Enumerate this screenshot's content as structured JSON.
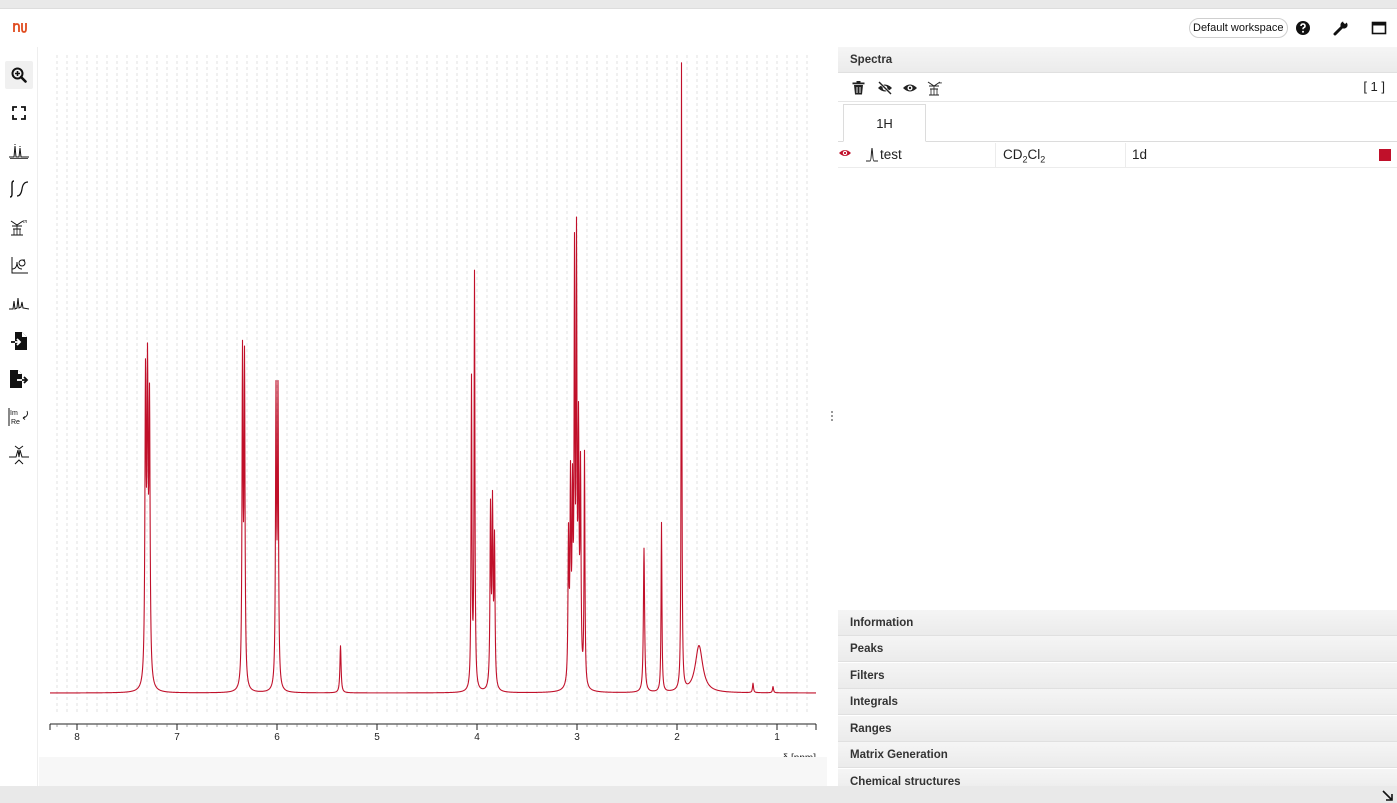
{
  "topbar": {
    "logo": "nmrium-logo",
    "workspace_label": "Default workspace",
    "icons": [
      "help-icon",
      "wrench-icon",
      "window-icon"
    ]
  },
  "toolbar": {
    "tools": [
      {
        "name": "zoom-tool",
        "icon": "zoom-in-icon",
        "active": true
      },
      {
        "name": "full-screen-tool",
        "icon": "fullscreen-icon"
      },
      {
        "name": "peak-picking-tool",
        "icon": "peak-picking-icon"
      },
      {
        "name": "integral-tool",
        "icon": "integral-icon"
      },
      {
        "name": "multiplet-tool",
        "icon": "multiplet-icon"
      },
      {
        "name": "phase-correction-tool",
        "icon": "phase-icon"
      },
      {
        "name": "baseline-tool",
        "icon": "baseline-icon"
      },
      {
        "name": "import-tool",
        "icon": "import-file-icon"
      },
      {
        "name": "export-tool",
        "icon": "export-file-icon"
      },
      {
        "name": "real-imaginary-tool",
        "icon": "real-imaginary-icon"
      },
      {
        "name": "spectra-alignment-tool",
        "icon": "alignment-icon"
      }
    ]
  },
  "chart_data": {
    "type": "line",
    "xlabel": "δ [ppm]",
    "x_reversed": true,
    "xlim": [
      8.27,
      0.61
    ],
    "ylim": [
      0,
      1
    ],
    "x_ticks": [
      8,
      7,
      6,
      5,
      4,
      3,
      2,
      1
    ],
    "grid": "vertical-dashed",
    "series": [
      {
        "name": "test",
        "color": "#c0102a",
        "peaks": [
          {
            "x": 7.315,
            "y": 0.47,
            "w": 0.007
          },
          {
            "x": 7.295,
            "y": 0.46,
            "w": 0.007
          },
          {
            "x": 7.275,
            "y": 0.43,
            "w": 0.007
          },
          {
            "x": 6.345,
            "y": 0.52,
            "w": 0.006
          },
          {
            "x": 6.325,
            "y": 0.51,
            "w": 0.006
          },
          {
            "x": 6.01,
            "y": 0.46,
            "w": 0.006
          },
          {
            "x": 5.99,
            "y": 0.46,
            "w": 0.006
          },
          {
            "x": 5.365,
            "y": 0.075,
            "w": 0.007
          },
          {
            "x": 4.055,
            "y": 0.49,
            "w": 0.005
          },
          {
            "x": 4.025,
            "y": 0.66,
            "w": 0.005
          },
          {
            "x": 3.865,
            "y": 0.28,
            "w": 0.006
          },
          {
            "x": 3.845,
            "y": 0.28,
            "w": 0.006
          },
          {
            "x": 3.825,
            "y": 0.23,
            "w": 0.006
          },
          {
            "x": 3.085,
            "y": 0.23,
            "w": 0.006
          },
          {
            "x": 3.065,
            "y": 0.31,
            "w": 0.006
          },
          {
            "x": 3.045,
            "y": 0.28,
            "w": 0.006
          },
          {
            "x": 3.025,
            "y": 0.65,
            "w": 0.005
          },
          {
            "x": 3.005,
            "y": 0.67,
            "w": 0.005
          },
          {
            "x": 2.985,
            "y": 0.38,
            "w": 0.006
          },
          {
            "x": 2.965,
            "y": 0.33,
            "w": 0.006
          },
          {
            "x": 2.925,
            "y": 0.37,
            "w": 0.005
          },
          {
            "x": 2.33,
            "y": 0.23,
            "w": 0.007
          },
          {
            "x": 2.155,
            "y": 0.27,
            "w": 0.005
          },
          {
            "x": 1.955,
            "y": 1.0,
            "w": 0.004
          },
          {
            "x": 1.78,
            "y": 0.075,
            "w": 0.045
          },
          {
            "x": 1.24,
            "y": 0.015,
            "w": 0.006
          },
          {
            "x": 1.04,
            "y": 0.01,
            "w": 0.006
          }
        ]
      }
    ]
  },
  "panel": {
    "spectra_title": "Spectra",
    "spectra_count": "[ 1 ]",
    "spectra_tools": [
      "delete-icon",
      "hide-all-icon",
      "show-all-icon",
      "filter-icon"
    ],
    "tab_label": "1H",
    "spectrum": {
      "name": "test",
      "solvent_main": "CD",
      "solvent_sub1": "2",
      "solvent_mid": "Cl",
      "solvent_sub2": "2",
      "dimension": "1d",
      "color": "#c0102a"
    },
    "sections": [
      "Information",
      "Peaks",
      "Filters",
      "Integrals",
      "Ranges",
      "Matrix Generation",
      "Chemical structures"
    ]
  }
}
